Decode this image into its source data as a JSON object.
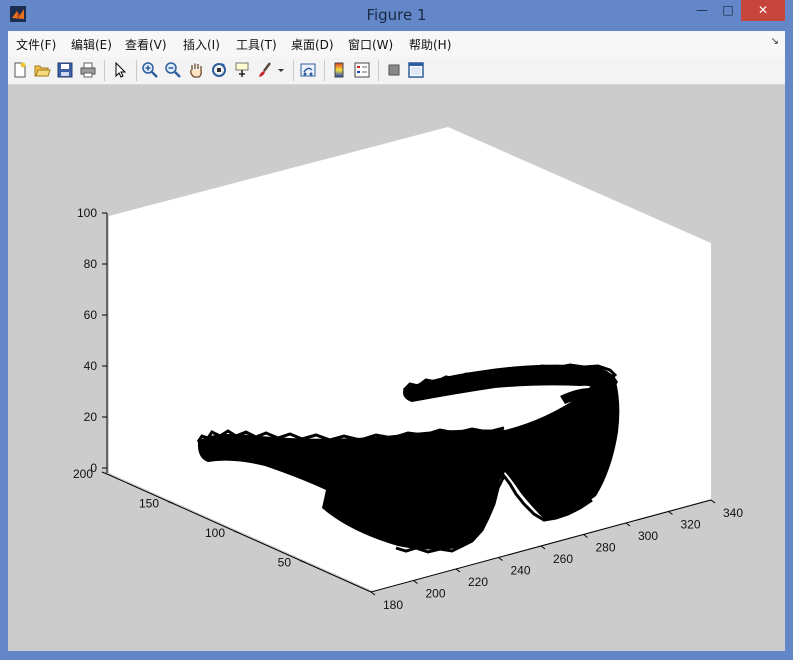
{
  "window": {
    "title": "Figure 1",
    "minimize_glyph": "—",
    "maximize_glyph": "□",
    "close_glyph": "✕"
  },
  "menubar": {
    "items": [
      {
        "label": "文件(F)"
      },
      {
        "label": "编辑(E)"
      },
      {
        "label": "查看(V)"
      },
      {
        "label": "插入(I)"
      },
      {
        "label": "工具(T)"
      },
      {
        "label": "桌面(D)"
      },
      {
        "label": "窗口(W)"
      },
      {
        "label": "帮助(H)"
      }
    ],
    "overflow_glyph": "↘"
  },
  "toolbar": {
    "icons": [
      "new-figure-icon",
      "open-file-icon",
      "save-icon",
      "print-icon",
      "pointer-icon",
      "zoom-in-icon",
      "zoom-out-icon",
      "pan-hand-icon",
      "rotate-3d-icon",
      "data-cursor-icon",
      "brush-icon",
      "dropdown-arrow-icon",
      "link-plot-icon",
      "colorbar-icon",
      "legend-icon",
      "hide-plot-tools-icon",
      "show-plot-tools-icon"
    ]
  },
  "colors": {
    "figure_bg": "#cccccc",
    "axes_bg": "#ffffff",
    "data": "#000000",
    "title_bar": "#6387c9",
    "close_button": "#c7463c"
  },
  "chart_data": {
    "type": "scatter",
    "title": "",
    "xlabel": "",
    "ylabel": "",
    "zlabel": "",
    "x_ticks": [
      "180",
      "200",
      "220",
      "240",
      "260",
      "280",
      "300",
      "320",
      "340"
    ],
    "y_ticks": [
      "50",
      "100",
      "150",
      "200"
    ],
    "z_ticks": [
      "0",
      "20",
      "40",
      "60",
      "80",
      "100"
    ],
    "xlim": [
      180,
      340
    ],
    "ylim": [
      0,
      200
    ],
    "zlim": [
      0,
      100
    ],
    "grid": false,
    "description_marker": "dense black point cloud shaped like a pair of sunglasses"
  }
}
